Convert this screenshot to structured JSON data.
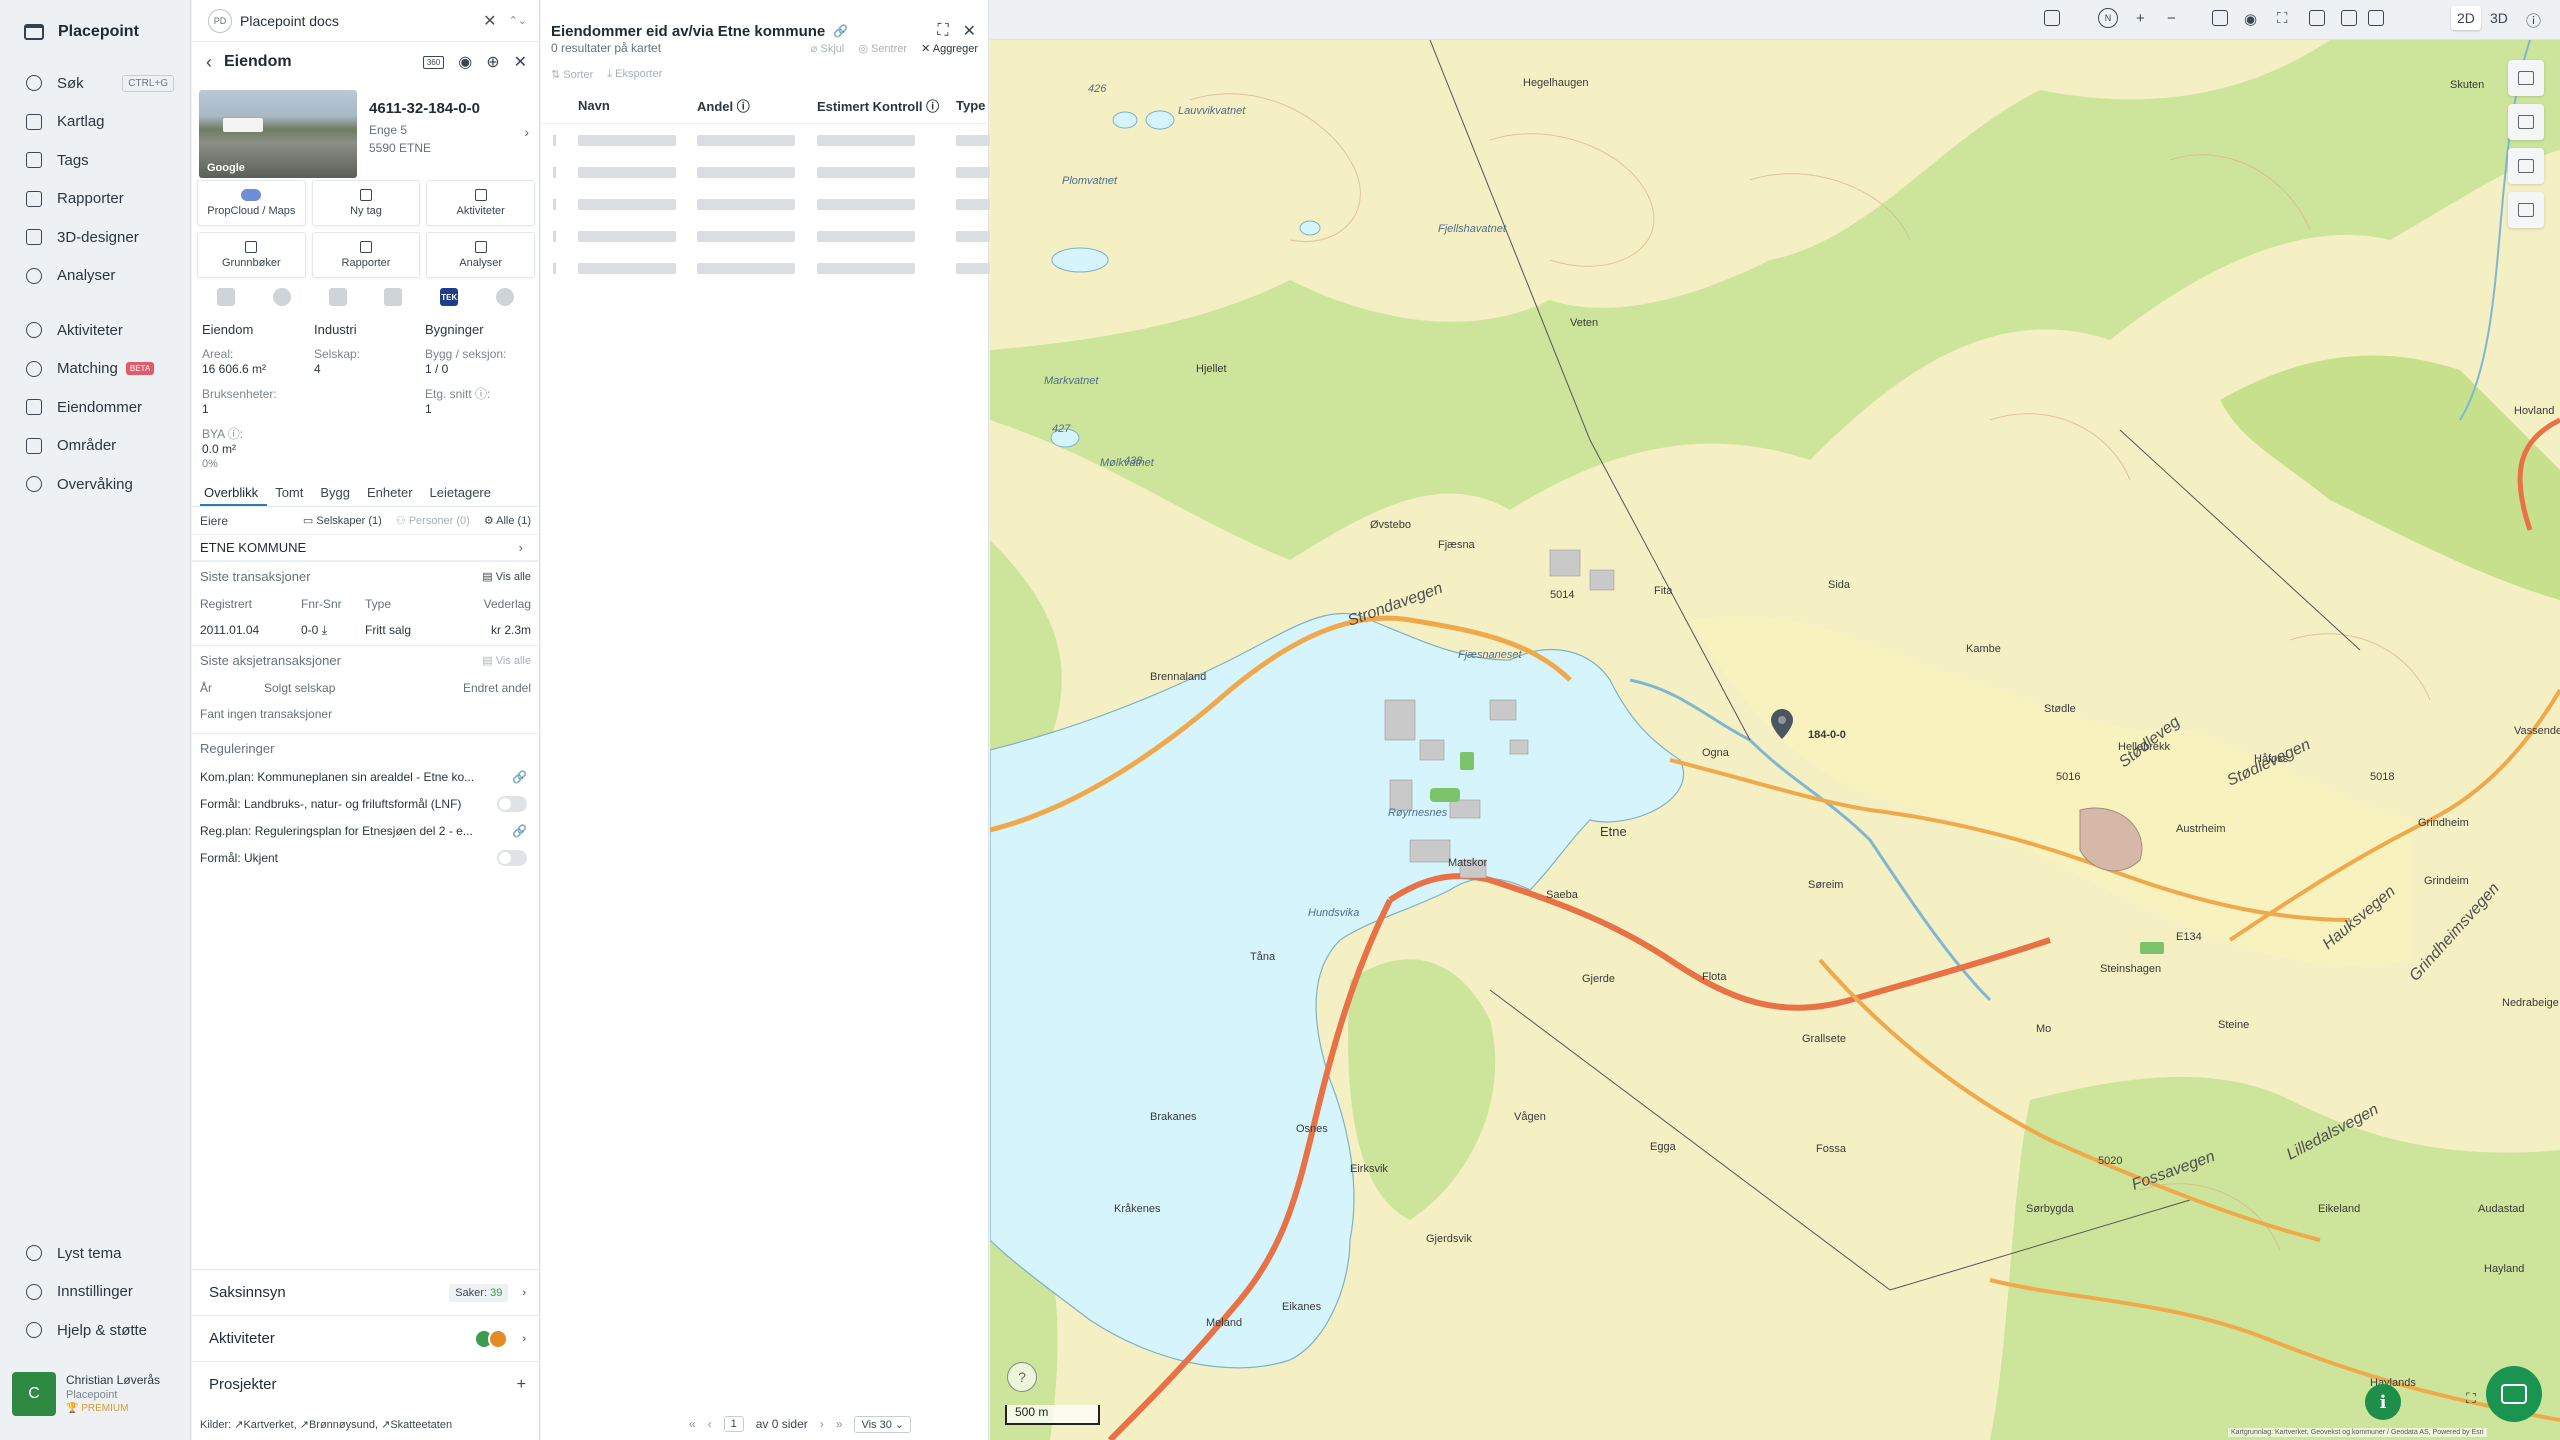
{
  "nav": {
    "brand": "Placepoint",
    "items": [
      {
        "label": "Søk",
        "icon": "search-icon",
        "shortcut": "CTRL+G"
      },
      {
        "label": "Kartlag",
        "icon": "layers-icon"
      },
      {
        "label": "Tags",
        "icon": "bookmark-icon"
      },
      {
        "label": "Rapporter",
        "icon": "chart-icon"
      },
      {
        "label": "3D-designer",
        "icon": "cube-icon"
      },
      {
        "label": "Analyser",
        "icon": "bolt-icon"
      },
      {
        "label": "Aktiviteter",
        "icon": "chat-icon"
      },
      {
        "label": "Matching",
        "icon": "match-icon",
        "badge": "BETA"
      },
      {
        "label": "Eiendommer",
        "icon": "building-icon"
      },
      {
        "label": "Områder",
        "icon": "area-icon"
      },
      {
        "label": "Overvåking",
        "icon": "monitor-icon"
      }
    ],
    "bottom": [
      {
        "label": "Lyst tema",
        "icon": "sun-icon"
      },
      {
        "label": "Innstillinger",
        "icon": "gear-icon"
      },
      {
        "label": "Hjelp & støtte",
        "icon": "help-icon"
      }
    ],
    "user": {
      "initial": "C",
      "name": "Christian Løverås",
      "company": "Placepoint",
      "plan": "PREMIUM"
    }
  },
  "docs": {
    "badge": "PD",
    "title": "Placepoint docs"
  },
  "property": {
    "header": "Eiendom",
    "badge_3d": "360",
    "id": "4611-32-184-0-0",
    "address1": "Enge 5",
    "address2": "5590 ETNE",
    "photo_credit": "Google",
    "actions": [
      "PropCloud / Maps",
      "Ny tag",
      "Aktiviteter",
      "Grunnbøker",
      "Rapporter",
      "Analyser"
    ],
    "tek_label": "TEK",
    "stats": {
      "col_heads": [
        "Eiendom",
        "Industri",
        "Bygninger"
      ],
      "areal_label": "Areal:",
      "areal_value": "16 606.6 m²",
      "selskap_label": "Selskap:",
      "selskap_value": "4",
      "bygg_label": "Bygg / seksjon:",
      "bygg_value": "1 / 0",
      "bruks_label": "Bruksenheter:",
      "bruks_value": "1",
      "etg_label": "Etg. snitt ⓘ:",
      "etg_value": "1",
      "bya_label": "BYA ⓘ:",
      "bya_value": "0.0 m²",
      "bya_pct": "0%"
    },
    "tabs": [
      "Overblikk",
      "Tomt",
      "Bygg",
      "Enheter",
      "Leietagere"
    ],
    "eiere": {
      "label": "Eiere",
      "selskaper": "Selskaper (1)",
      "personer": "Personer (0)",
      "alle": "Alle (1)",
      "owner": "ETNE KOMMUNE"
    },
    "transactions": {
      "title": "Siste transaksjoner",
      "link": "Vis alle",
      "columns": [
        "Registrert",
        "Fnr-Snr",
        "Type",
        "Vederlag"
      ],
      "rows": [
        {
          "date": "2011.01.04",
          "fnr": "0-0",
          "type": "Fritt salg",
          "price": "kr 2.3m"
        }
      ]
    },
    "share_tx": {
      "title": "Siste aksjetransaksjoner",
      "link": "Vis alle",
      "columns": [
        "År",
        "Solgt selskap",
        "Endret andel"
      ],
      "empty": "Fant ingen transaksjoner"
    },
    "regulations": {
      "title": "Reguleringer",
      "items": [
        {
          "text": "Kom.plan: Kommuneplanen sin arealdel - Etne ko...",
          "kind": "link"
        },
        {
          "text": "Formål: Landbruks-, natur- og friluftsformål (LNF)",
          "kind": "toggle"
        },
        {
          "text": "Reg.plan: Reguleringsplan for Etnesjøen del 2 - e...",
          "kind": "link"
        },
        {
          "text": "Formål: Ukjent",
          "kind": "toggle"
        }
      ]
    },
    "accordions": {
      "saksinnsyn": "Saksinnsyn",
      "saker_label": "Saker:",
      "saker_count": "39",
      "aktiviteter": "Aktiviteter",
      "prosjekter": "Prosjekter"
    },
    "sources": {
      "label": "Kilder:",
      "items": [
        "Kartverket",
        "Brønnøysund",
        "Skatteetaten"
      ]
    }
  },
  "owned": {
    "title": "Eiendommer eid av/via Etne kommune",
    "count_text": "0 resultater på kartet",
    "actions": {
      "hide": "Skjul",
      "center": "Sentrer",
      "aggregate": "Aggreger"
    },
    "tools": {
      "sort": "Sorter",
      "export": "Eksporter"
    },
    "columns": [
      "Navn",
      "Andel ⓘ",
      "Estimert Kontroll ⓘ",
      "Type"
    ],
    "pager": {
      "page": "1",
      "of_text": "av 0 sider",
      "per_page": "Vis 30"
    }
  },
  "map": {
    "modes": {
      "two_d": "2D",
      "three_d": "3D"
    },
    "marker_label": "184-0-0",
    "scale": "500 m",
    "help": "?",
    "info": "i",
    "attribution": "Kartgrunnlag: Kartverket, Geovekst og kommuner / Geodata AS, Powered by Esri",
    "road_labels": [
      "Strondavegen",
      "Stødlevegen",
      "Hauksvegen",
      "Grindheimsvegen",
      "Fossavegen",
      "Lilledalsvegen",
      "Stødleveg"
    ],
    "place_labels": [
      "Hegelhaugen",
      "Skuten",
      "Lauvvikvatnet",
      "Plomvatnet",
      "Fjellshavatnet",
      "Veten",
      "Hjellet",
      "Øvstebo",
      "Fjæsna",
      "Fita",
      "Sida",
      "Kambe",
      "Stødle",
      "Hellebrekk",
      "Håfoss",
      "Vassende",
      "Hovland",
      "Fjæsnaneset",
      "Brennaland",
      "Røyrnesnes",
      "Etne",
      "Grindheim",
      "Austrheim",
      "Grindeim",
      "Saeba",
      "Matskor",
      "Hundsvika",
      "Tåna",
      "Gjerde",
      "Flota",
      "Søreim",
      "Steinshagen",
      "Mo",
      "Steine",
      "Nedrabeige",
      "Grallsete",
      "Brakanes",
      "Osnes",
      "Vågen",
      "Egga",
      "Fossa",
      "Eirksvik",
      "Kråkenes",
      "Gjerdsvik",
      "Sørbygda",
      "Eikeland",
      "Audastad",
      "Hayland",
      "Haylands",
      "Eikanes",
      "Meland",
      "Ogna",
      "Markvatnet",
      "Mølkvatnet"
    ],
    "lake_numbers": [
      "426",
      "427",
      "438"
    ],
    "road_numbers": [
      "5014",
      "5016",
      "E134",
      "5018",
      "5020"
    ]
  },
  "colors": {
    "accent": "#2a7cb6",
    "green": "#1e8f4a",
    "water": "#d6f4fb",
    "land": "#f5efc4",
    "forest": "#c6e08c",
    "road": "#e87146"
  }
}
